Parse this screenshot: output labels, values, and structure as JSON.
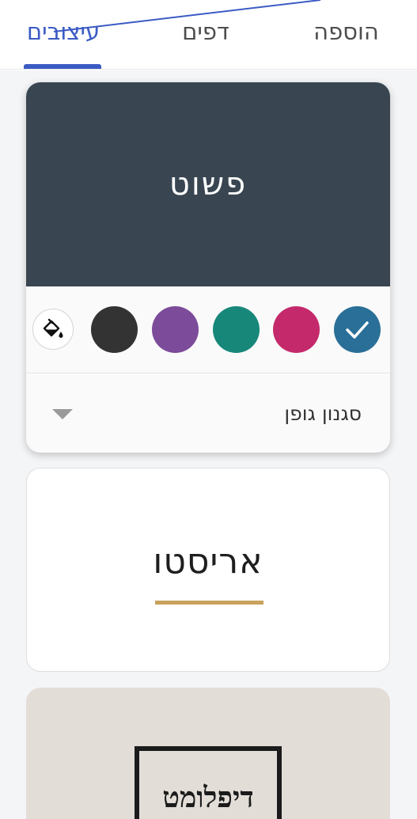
{
  "tabs": [
    {
      "label": "הוספה"
    },
    {
      "label": "דפים"
    },
    {
      "label": "עיצובים",
      "active": true
    }
  ],
  "themes": {
    "simple": {
      "title": "פשוט",
      "preview_color": "#394651",
      "swatches": [
        {
          "name": "blue",
          "color": "#2a6f97",
          "selected": true
        },
        {
          "name": "magenta",
          "color": "#c42a6b",
          "selected": false
        },
        {
          "name": "green",
          "color": "#17877a",
          "selected": false
        },
        {
          "name": "purple",
          "color": "#7c4b9a",
          "selected": false
        },
        {
          "name": "black",
          "color": "#333333",
          "selected": false
        }
      ],
      "custom_color_icon": "paint-bucket-icon",
      "font_style_label": "סגנון גופן",
      "font_style_icon": "caret-down-icon"
    },
    "aristo": {
      "title": "אריסטו",
      "accent_color": "#c9a25e"
    },
    "diplomat": {
      "title": "דיפלומט",
      "background_color": "#e3ddd8"
    }
  },
  "accent_color": "#3b5bc4"
}
